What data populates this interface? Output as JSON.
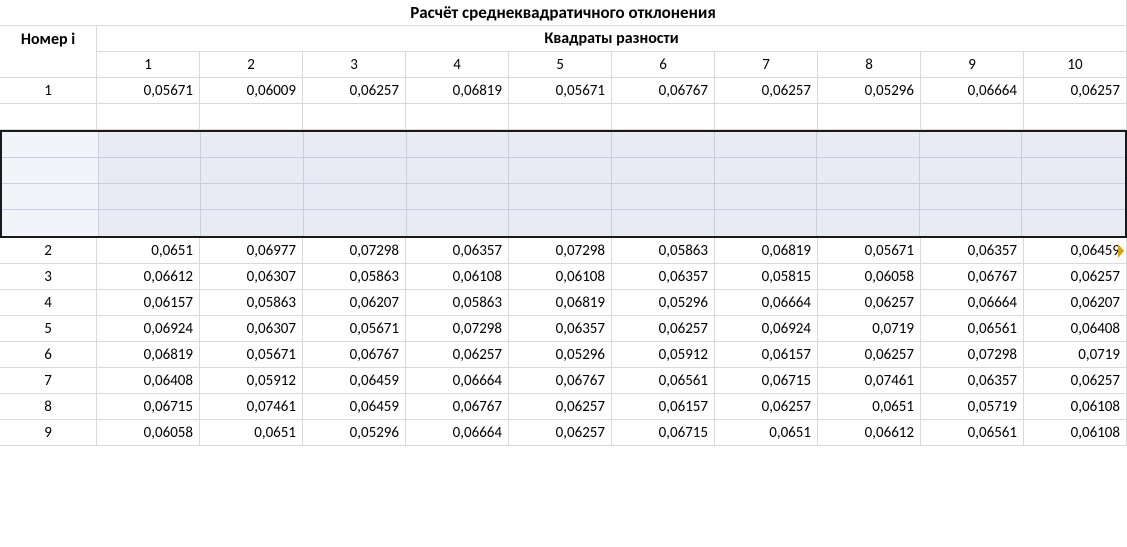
{
  "titles": {
    "main": "Расчёт среднеквадратичного отклонения",
    "sub": "Квадраты разности",
    "row_label": "Номер i"
  },
  "col_headers": [
    "1",
    "2",
    "3",
    "4",
    "5",
    "6",
    "7",
    "8",
    "9",
    "10"
  ],
  "rows": [
    {
      "label": "1",
      "vals": [
        "0,05671",
        "0,06009",
        "0,06257",
        "0,06819",
        "0,05671",
        "0,06767",
        "0,06257",
        "0,05296",
        "0,06664",
        "0,06257"
      ]
    },
    {
      "label": "2",
      "vals": [
        "0,0651",
        "0,06977",
        "0,07298",
        "0,06357",
        "0,07298",
        "0,05863",
        "0,06819",
        "0,05671",
        "0,06357",
        "0,06459"
      ]
    },
    {
      "label": "3",
      "vals": [
        "0,06612",
        "0,06307",
        "0,05863",
        "0,06108",
        "0,06108",
        "0,06357",
        "0,05815",
        "0,06058",
        "0,06767",
        "0,06257"
      ]
    },
    {
      "label": "4",
      "vals": [
        "0,06157",
        "0,05863",
        "0,06207",
        "0,05863",
        "0,06819",
        "0,05296",
        "0,06664",
        "0,06257",
        "0,06664",
        "0,06207"
      ]
    },
    {
      "label": "5",
      "vals": [
        "0,06924",
        "0,06307",
        "0,05671",
        "0,07298",
        "0,06357",
        "0,06257",
        "0,06924",
        "0,0719",
        "0,06561",
        "0,06408"
      ]
    },
    {
      "label": "6",
      "vals": [
        "0,06819",
        "0,05671",
        "0,06767",
        "0,06257",
        "0,05296",
        "0,05912",
        "0,06157",
        "0,06257",
        "0,07298",
        "0,0719"
      ]
    },
    {
      "label": "7",
      "vals": [
        "0,06408",
        "0,05912",
        "0,06459",
        "0,06664",
        "0,06767",
        "0,06561",
        "0,06715",
        "0,07461",
        "0,06357",
        "0,06257"
      ]
    },
    {
      "label": "8",
      "vals": [
        "0,06715",
        "0,07461",
        "0,06459",
        "0,06767",
        "0,06257",
        "0,06157",
        "0,06257",
        "0,0651",
        "0,05719",
        "0,06108"
      ]
    },
    {
      "label": "9",
      "vals": [
        "0,06058",
        "0,0651",
        "0,05296",
        "0,06664",
        "0,06257",
        "0,06715",
        "0,0651",
        "0,06612",
        "0,06561",
        "0,06108"
      ]
    }
  ],
  "selection": {
    "blank_rows": 4
  }
}
